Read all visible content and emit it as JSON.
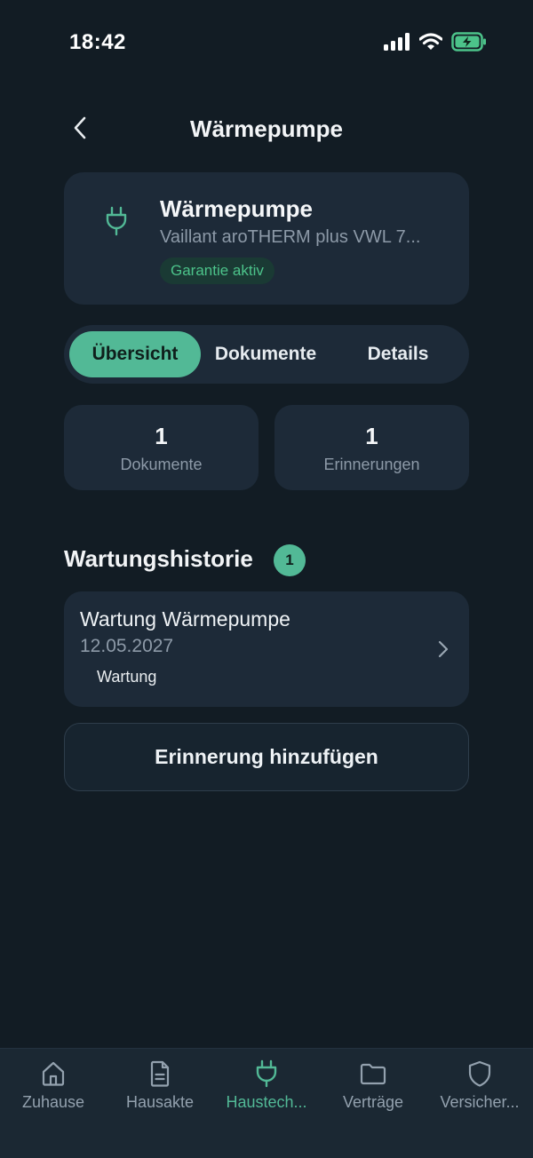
{
  "status_bar": {
    "time": "18:42"
  },
  "header": {
    "title": "Wärmepumpe"
  },
  "device": {
    "title": "Wärmepumpe",
    "subtitle": "Vaillant aroTHERM plus VWL 7...",
    "badge": "Garantie aktiv",
    "icon": "plug-icon"
  },
  "tabs": [
    {
      "label": "Übersicht",
      "active": true
    },
    {
      "label": "Dokumente",
      "active": false
    },
    {
      "label": "Details",
      "active": false
    }
  ],
  "stats": [
    {
      "value": "1",
      "label": "Dokumente"
    },
    {
      "value": "1",
      "label": "Erinnerungen"
    }
  ],
  "history": {
    "title": "Wartungshistorie",
    "count": "1",
    "items": [
      {
        "title": "Wartung Wärmepumpe",
        "date": "12.05.2027",
        "tag": "Wartung"
      }
    ]
  },
  "add_button": {
    "label": "Erinnerung hinzufügen"
  },
  "tabbar": [
    {
      "label": "Zuhause",
      "icon": "home-icon",
      "active": false
    },
    {
      "label": "Hausakte",
      "icon": "document-icon",
      "active": false
    },
    {
      "label": "Haustech...",
      "icon": "plug-icon",
      "active": true
    },
    {
      "label": "Verträge",
      "icon": "folder-icon",
      "active": false
    },
    {
      "label": "Versicher...",
      "icon": "shield-icon",
      "active": false
    }
  ],
  "colors": {
    "background": "#121c24",
    "card": "#1d2a38",
    "accent": "#52b996",
    "badge_text": "#4cc38a"
  }
}
